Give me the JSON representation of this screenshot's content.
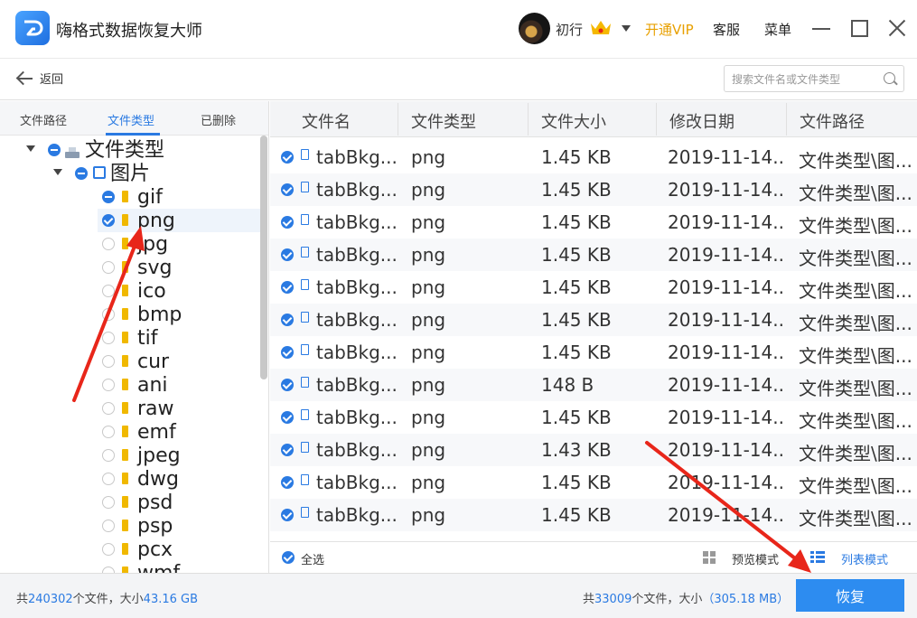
{
  "app": {
    "title": "嗨格式数据恢复大师"
  },
  "user": {
    "name": "初行",
    "vip_label": "开通VIP",
    "service_label": "客服",
    "menu_label": "菜单"
  },
  "toolbar": {
    "back_label": "返回",
    "search_placeholder": "搜索文件名或文件类型"
  },
  "left_tabs": [
    {
      "label": "文件路径",
      "active": false
    },
    {
      "label": "文件类型",
      "active": true
    },
    {
      "label": "已删除",
      "active": false
    }
  ],
  "tree": {
    "root_label": "文件类型",
    "group_label": "图片",
    "items": [
      {
        "label": "gif",
        "state": "partial"
      },
      {
        "label": "png",
        "state": "checked"
      },
      {
        "label": "jpg",
        "state": "empty"
      },
      {
        "label": "svg",
        "state": "empty"
      },
      {
        "label": "ico",
        "state": "empty"
      },
      {
        "label": "bmp",
        "state": "empty"
      },
      {
        "label": "tif",
        "state": "empty"
      },
      {
        "label": "cur",
        "state": "empty"
      },
      {
        "label": "ani",
        "state": "empty"
      },
      {
        "label": "raw",
        "state": "empty"
      },
      {
        "label": "emf",
        "state": "empty"
      },
      {
        "label": "jpeg",
        "state": "empty"
      },
      {
        "label": "dwg",
        "state": "empty"
      },
      {
        "label": "psd",
        "state": "empty"
      },
      {
        "label": "psp",
        "state": "empty"
      },
      {
        "label": "pcx",
        "state": "empty"
      },
      {
        "label": "wmf",
        "state": "empty"
      }
    ]
  },
  "table": {
    "columns": [
      "文件名",
      "文件类型",
      "文件大小",
      "修改日期",
      "文件路径"
    ],
    "rows": [
      {
        "name": "tabBkg....",
        "type": "png",
        "size": "1.45 KB",
        "date": "2019-11-14...",
        "path": "文件类型\\图..."
      },
      {
        "name": "tabBkg....",
        "type": "png",
        "size": "1.45 KB",
        "date": "2019-11-14...",
        "path": "文件类型\\图..."
      },
      {
        "name": "tabBkg....",
        "type": "png",
        "size": "1.45 KB",
        "date": "2019-11-14...",
        "path": "文件类型\\图..."
      },
      {
        "name": "tabBkg....",
        "type": "png",
        "size": "1.45 KB",
        "date": "2019-11-14...",
        "path": "文件类型\\图..."
      },
      {
        "name": "tabBkg....",
        "type": "png",
        "size": "1.45 KB",
        "date": "2019-11-14...",
        "path": "文件类型\\图..."
      },
      {
        "name": "tabBkg....",
        "type": "png",
        "size": "1.45 KB",
        "date": "2019-11-14...",
        "path": "文件类型\\图..."
      },
      {
        "name": "tabBkg....",
        "type": "png",
        "size": "1.45 KB",
        "date": "2019-11-14...",
        "path": "文件类型\\图..."
      },
      {
        "name": "tabBkg....",
        "type": "png",
        "size": "148 B",
        "date": "2019-11-14...",
        "path": "文件类型\\图..."
      },
      {
        "name": "tabBkg....",
        "type": "png",
        "size": "1.45 KB",
        "date": "2019-11-14...",
        "path": "文件类型\\图..."
      },
      {
        "name": "tabBkg....",
        "type": "png",
        "size": "1.43 KB",
        "date": "2019-11-14...",
        "path": "文件类型\\图..."
      },
      {
        "name": "tabBkg....",
        "type": "png",
        "size": "1.45 KB",
        "date": "2019-11-14...",
        "path": "文件类型\\图..."
      },
      {
        "name": "tabBkg....",
        "type": "png",
        "size": "1.45 KB",
        "date": "2019-11-14...",
        "path": "文件类型\\图..."
      }
    ]
  },
  "list_footer": {
    "select_all_label": "全选",
    "preview_label": "预览模式",
    "list_label": "列表模式"
  },
  "status": {
    "total_prefix": "共",
    "total_count": "240302",
    "total_mid": "个文件，大小",
    "total_size": "43.16 GB",
    "selected_prefix": "共",
    "selected_count": "33009",
    "selected_mid": "个文件，大小",
    "selected_size": "（305.18 MB）",
    "recover_label": "恢复"
  },
  "colors": {
    "accent": "#2a7ae2",
    "vip": "#e8a000",
    "arrow": "#e8261a",
    "button": "#2d8cf0"
  }
}
